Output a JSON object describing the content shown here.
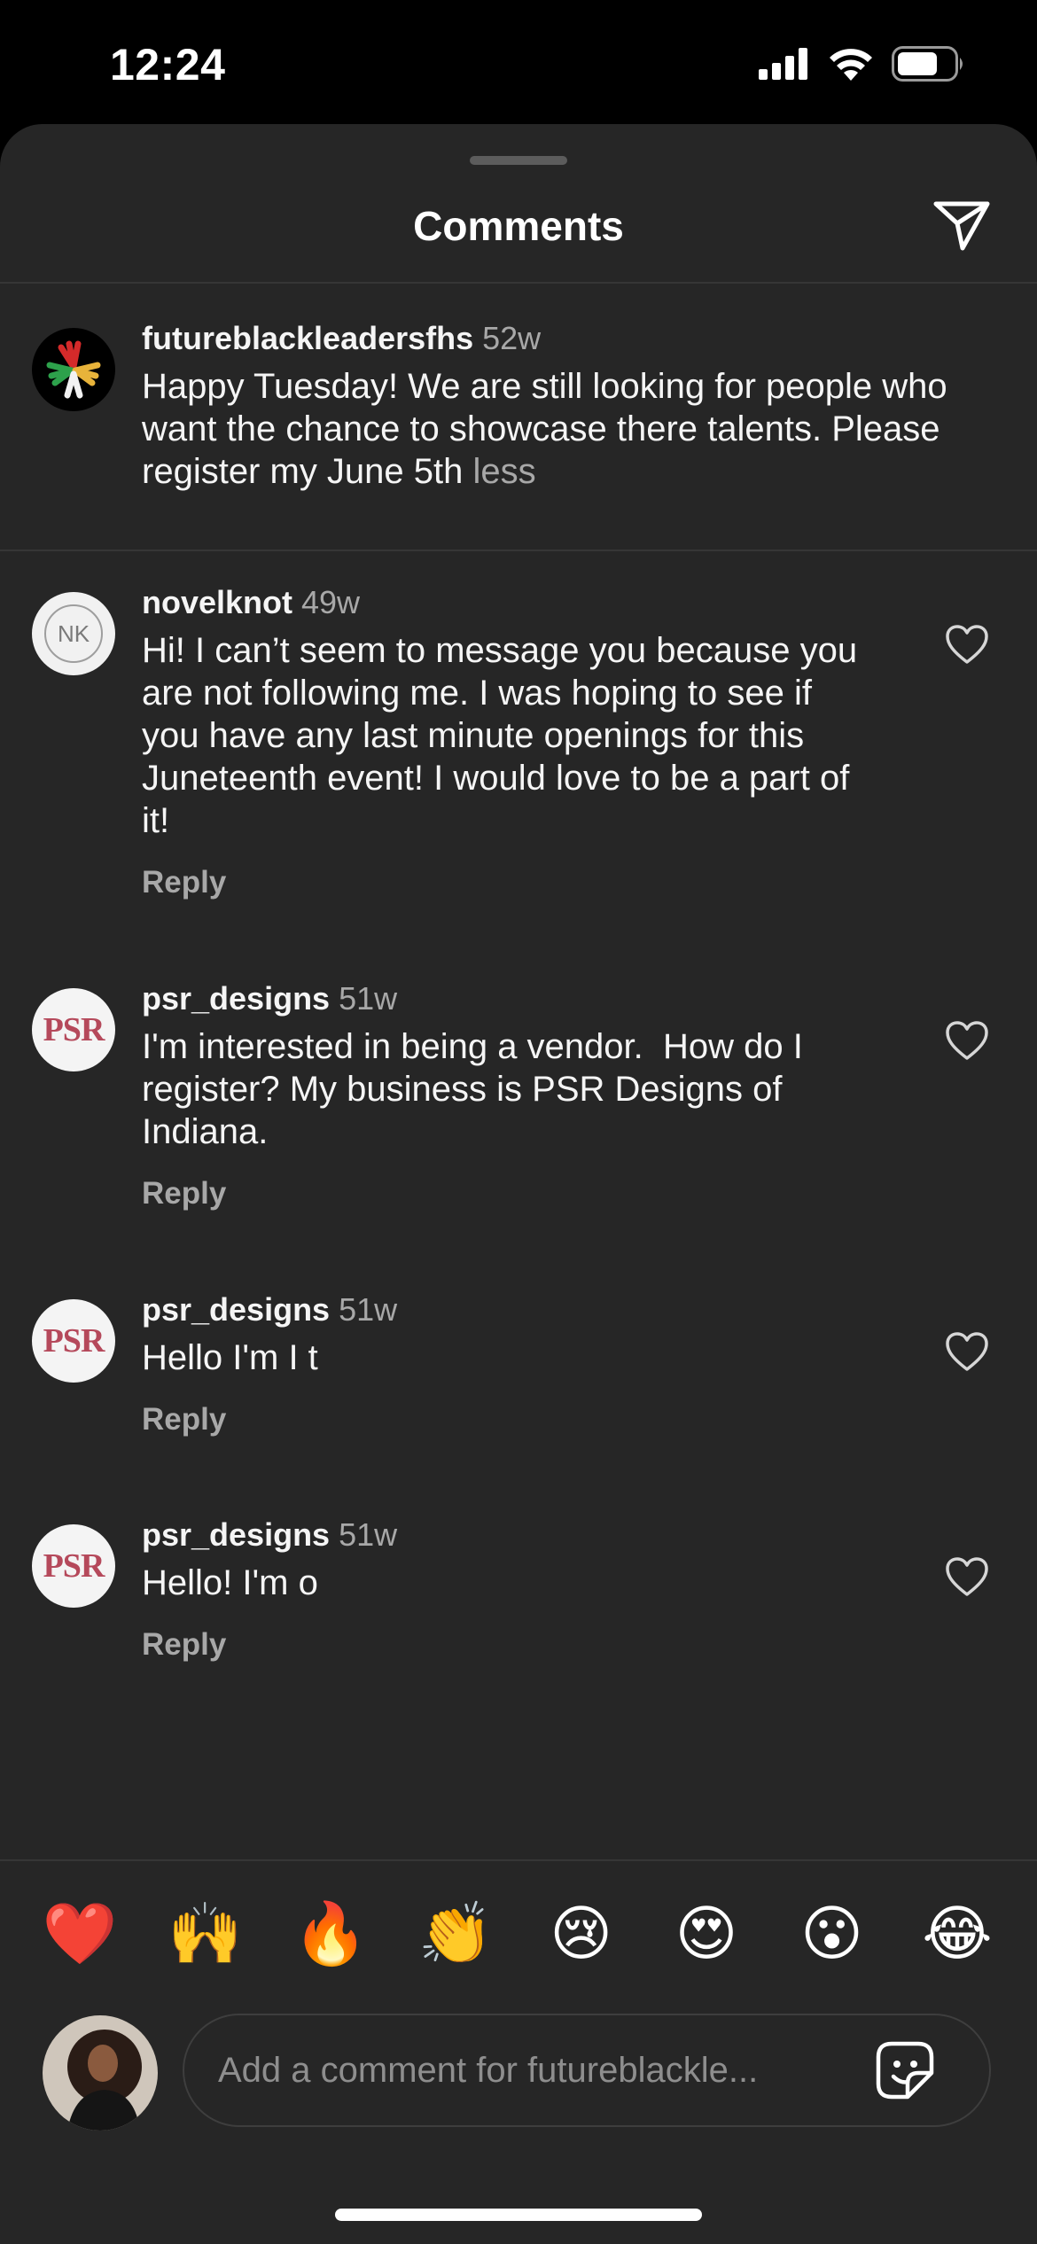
{
  "status_bar": {
    "time": "12:24",
    "icons": [
      "cellular-signal-icon",
      "wifi-icon",
      "battery-icon"
    ]
  },
  "header": {
    "title": "Comments",
    "share_icon": "send-paper-plane-icon"
  },
  "caption": {
    "username": "futureblackleadersfhs",
    "time": "52w",
    "text": "Happy Tuesday! We are still looking for people who want the chance to showcase there talents. Please register my June 5th ",
    "less_label": "less"
  },
  "comments": [
    {
      "username": "novelknot",
      "time": "49w",
      "avatar_initials": "NK",
      "text": "Hi! I can’t seem to message you because you are not following me. I was hoping to see if you have any last minute openings for this Juneteenth event! I would love to be a part of it!",
      "reply_label": "Reply"
    },
    {
      "username": "psr_designs",
      "time": "51w",
      "avatar_initials": "PSR",
      "text": "I'm interested in being a vendor.  How do I register? My business is PSR Designs of Indiana.",
      "reply_label": "Reply"
    },
    {
      "username": "psr_designs",
      "time": "51w",
      "avatar_initials": "PSR",
      "text": "Hello I'm I t",
      "reply_label": "Reply"
    },
    {
      "username": "psr_designs",
      "time": "51w",
      "avatar_initials": "PSR",
      "text": "Hello! I'm o",
      "reply_label": "Reply"
    }
  ],
  "emoji_reactions": [
    "❤️",
    "🙌",
    "🔥",
    "👏",
    "😢",
    "😍",
    "😮",
    "😂"
  ],
  "compose": {
    "placeholder": "Add a comment for futureblackle...",
    "sticker_icon": "sticker-icon"
  },
  "colors": {
    "background": "#262626",
    "secondary_text": "#a8a8a8",
    "divider": "#363636"
  }
}
